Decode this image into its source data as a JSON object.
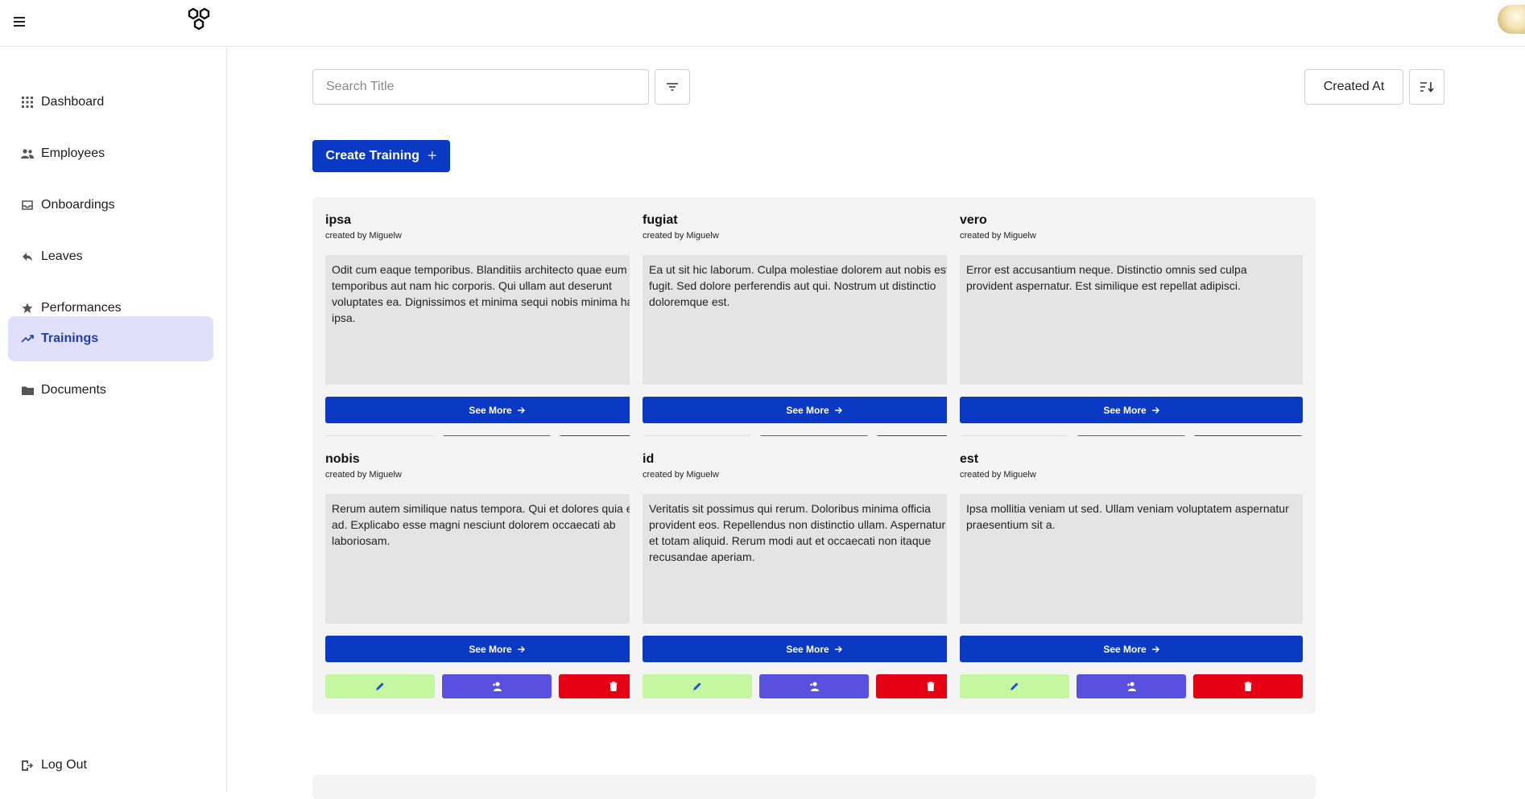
{
  "sidebar": {
    "items": [
      {
        "label": "Dashboard",
        "icon": "grid-icon"
      },
      {
        "label": "Employees",
        "icon": "people-icon"
      },
      {
        "label": "Onboardings",
        "icon": "inbox-icon"
      },
      {
        "label": "Leaves",
        "icon": "reply-icon"
      },
      {
        "label": "Performances",
        "icon": "star-icon"
      },
      {
        "label": "Trainings",
        "icon": "trending-up-icon",
        "active": true
      },
      {
        "label": "Documents",
        "icon": "folder-icon"
      }
    ],
    "logout_label": "Log Out"
  },
  "toolbar": {
    "search_placeholder": "Search Title",
    "search_value": "",
    "sort_field": "Created At",
    "create_label": "Create Training"
  },
  "colors": {
    "primary": "#0a3ac4",
    "active_nav_bg": "#e1e0fb",
    "edit_bg": "#c4f7a0",
    "assign_bg": "#5a50e0",
    "delete_bg": "#e60014"
  },
  "trainings": [
    {
      "title": "ipsa",
      "author": "created by Miguelw",
      "description": "Odit cum eaque temporibus. Blanditiis architecto quae eum temporibus aut nam hic corporis. Qui ullam aut deserunt voluptates ea. Dignissimos et minima sequi nobis minima harum ipsa.",
      "see_more": "See More"
    },
    {
      "title": "fugiat",
      "author": "created by Miguelw",
      "description": "Ea ut sit hic laborum. Culpa molestiae dolorem aut nobis est alias fugit. Sed dolore perferendis aut qui. Nostrum ut distinctio doloremque est.",
      "see_more": "See More"
    },
    {
      "title": "vero",
      "author": "created by Miguelw",
      "description": "Error est accusantium neque. Distinctio omnis sed culpa provident aspernatur. Est similique est repellat adipisci.",
      "see_more": "See More"
    },
    {
      "title": "nobis",
      "author": "created by Miguelw",
      "description": "Rerum autem similique natus tempora. Qui et dolores quia et id et ad. Explicabo esse magni nesciunt dolorem occaecati ab laboriosam.",
      "see_more": "See More"
    },
    {
      "title": "id",
      "author": "created by Miguelw",
      "description": "Veritatis sit possimus qui rerum. Doloribus minima officia provident eos. Repellendus non distinctio ullam. Aspernatur eum et totam aliquid. Rerum modi aut et occaecati non itaque recusandae aperiam.",
      "see_more": "See More"
    },
    {
      "title": "est",
      "author": "created by Miguelw",
      "description": "Ipsa mollitia veniam ut sed. Ullam veniam voluptatem aspernatur praesentium sit a.",
      "see_more": "See More"
    }
  ]
}
